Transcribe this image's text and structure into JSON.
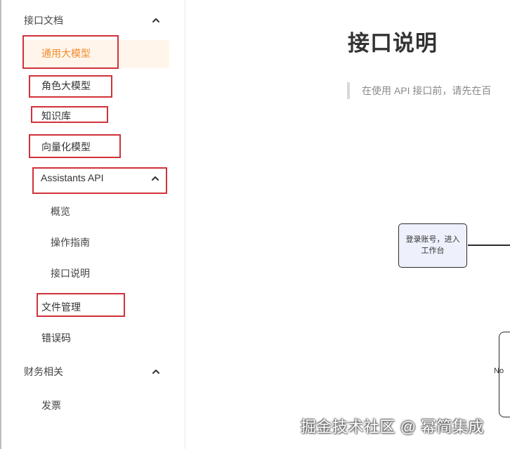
{
  "sidebar": {
    "section_api_docs": "接口文档",
    "items": {
      "general_llm": "通用大模型",
      "role_llm": "角色大模型",
      "knowledge_base": "知识库",
      "vectorization": "向量化模型",
      "assistants_api": "Assistants API",
      "overview": "概览",
      "guide": "操作指南",
      "api_desc": "接口说明",
      "file_management": "文件管理",
      "error_codes": "错误码"
    },
    "section_finance": "财务相关",
    "invoice": "发票"
  },
  "main": {
    "title": "接口说明",
    "notice": "在使用 API 接口前，请先在百",
    "flow": {
      "step1_line1": "登录账号，进入",
      "step1_line2": "工作台",
      "no_label": "No"
    }
  },
  "watermark": "掘金技术社区 @ 幂简集成",
  "colors": {
    "accent": "#f08c2c",
    "active_bg": "#fff5eb",
    "annotation_red": "#d0323a",
    "flow_box_fill": "#eef1fb"
  },
  "icons": {
    "expand": "chevron-up-icon"
  }
}
